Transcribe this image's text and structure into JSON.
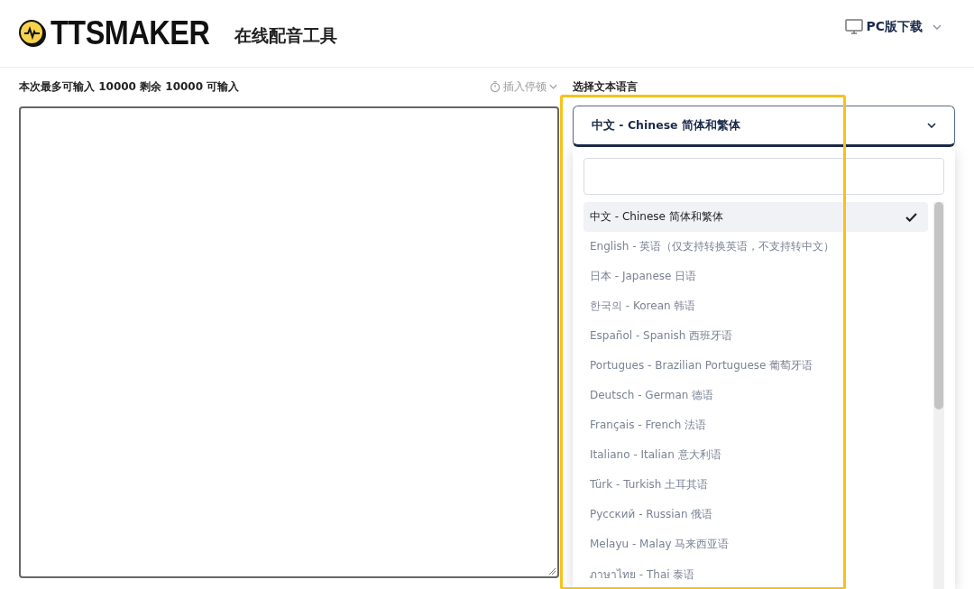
{
  "header": {
    "logo_text": "TTSMAKER",
    "subtitle": "在线配音工具",
    "download": "PC版下载"
  },
  "editor": {
    "limit_label": "本次最多可输入 10000 剩余 10000 可输入",
    "pause_button": "插入停顿"
  },
  "language": {
    "label": "选择文本语言",
    "selected_value": "中文 - Chinese 简体和繁体",
    "expanded": true,
    "options": [
      {
        "label": "中文 - Chinese 简体和繁体",
        "selected": true
      },
      {
        "label": "English - 英语（仅支持转换英语，不支持转中文）",
        "selected": false
      },
      {
        "label": "日本 - Japanese 日语",
        "selected": false
      },
      {
        "label": "한국의 - Korean 韩语",
        "selected": false
      },
      {
        "label": "Español - Spanish 西班牙语",
        "selected": false
      },
      {
        "label": "Portugues - Brazilian Portuguese 葡萄牙语",
        "selected": false
      },
      {
        "label": "Deutsch - German 德语",
        "selected": false
      },
      {
        "label": "Français - French 法语",
        "selected": false
      },
      {
        "label": "Italiano - Italian 意大利语",
        "selected": false
      },
      {
        "label": "Türk - Turkish 土耳其语",
        "selected": false
      },
      {
        "label": "Русский - Russian 俄语",
        "selected": false
      },
      {
        "label": "Melayu - Malay 马来西亚语",
        "selected": false
      },
      {
        "label": "ภาษาไทย - Thai 泰语",
        "selected": false
      }
    ]
  }
}
